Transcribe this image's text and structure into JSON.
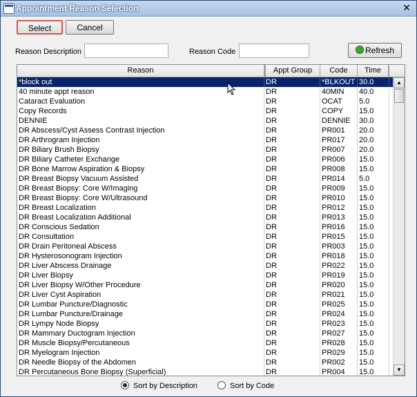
{
  "window": {
    "title": "Appointment Reason Selection",
    "close_glyph": "✕"
  },
  "toolbar": {
    "select_label": "Select",
    "cancel_label": "Cancel",
    "refresh_label": "Refresh",
    "refresh_icon": "refresh-icon"
  },
  "filters": {
    "reason_desc_label": "Reason Description",
    "reason_desc_value": "",
    "reason_code_label": "Reason Code",
    "reason_code_value": ""
  },
  "grid": {
    "columns": [
      "Reason",
      "Appt Group",
      "Code",
      "Time"
    ],
    "selected_index": 0,
    "rows": [
      [
        "*block out",
        "DR",
        "*BLKOUT",
        "30.0"
      ],
      [
        "40 minute appt reason",
        "DR",
        "40MIN",
        "40.0"
      ],
      [
        "Cataract Evaluation",
        "DR",
        "OCAT",
        "5.0"
      ],
      [
        "Copy Records",
        "DR",
        "COPY",
        "15.0"
      ],
      [
        "DENNIE",
        "DR",
        "DENNIE",
        "30.0"
      ],
      [
        "DR Abscess/Cyst Assess Contrast Injection",
        "DR",
        "PR001",
        "20.0"
      ],
      [
        "DR Arthrogram Injection",
        "DR",
        "PR017",
        "20.0"
      ],
      [
        "DR Biliary Brush Biopsy",
        "DR",
        "PR007",
        "20.0"
      ],
      [
        "DR Biliary Catheter Exchange",
        "DR",
        "PR006",
        "15.0"
      ],
      [
        "DR Bone Marrow Aspiration & Biopsy",
        "DR",
        "PR008",
        "15.0"
      ],
      [
        "DR Breast Biopsy Vacuum Assisted",
        "DR",
        "PR014",
        "5.0"
      ],
      [
        "DR Breast Biopsy: Core W/Imaging",
        "DR",
        "PR009",
        "15.0"
      ],
      [
        "DR Breast Biopsy: Core W/Ultrasound",
        "DR",
        "PR010",
        "15.0"
      ],
      [
        "DR Breast Localization",
        "DR",
        "PR012",
        "15.0"
      ],
      [
        "DR Breast Localization Additional",
        "DR",
        "PR013",
        "15.0"
      ],
      [
        "DR Conscious Sedation",
        "DR",
        "PR016",
        "15.0"
      ],
      [
        "DR Consultation",
        "DR",
        "PR015",
        "15.0"
      ],
      [
        "DR Drain Peritoneal Abscess",
        "DR",
        "PR003",
        "15.0"
      ],
      [
        "DR Hysterosonogram Injection",
        "DR",
        "PR018",
        "15.0"
      ],
      [
        "DR Liver Abscess Drainage",
        "DR",
        "PR022",
        "15.0"
      ],
      [
        "DR Liver Biopsy",
        "DR",
        "PR019",
        "15.0"
      ],
      [
        "DR Liver Biopsy W/Other Procedure",
        "DR",
        "PR020",
        "15.0"
      ],
      [
        "DR Liver Cyst Aspiration",
        "DR",
        "PR021",
        "15.0"
      ],
      [
        "DR Lumbar Puncture/Diagnostic",
        "DR",
        "PR025",
        "15.0"
      ],
      [
        "DR Lumbar Puncture/Drainage",
        "DR",
        "PR024",
        "15.0"
      ],
      [
        "DR Lympy Node Biopsy",
        "DR",
        "PR023",
        "15.0"
      ],
      [
        "DR Mammary Ductogram Injection",
        "DR",
        "PR027",
        "15.0"
      ],
      [
        "DR Muscle Biopsy/Percutaneous",
        "DR",
        "PR028",
        "15.0"
      ],
      [
        "DR Myelogram Injection",
        "DR",
        "PR029",
        "15.0"
      ],
      [
        "DR Needle Biopsy of the Abdomen",
        "DR",
        "PR002",
        "15.0"
      ],
      [
        "DR Percutaneous Bone Biopsy (Superficial)",
        "DR",
        "PR004",
        "15.0"
      ]
    ]
  },
  "sort": {
    "by_description_label": "Sort by Description",
    "by_code_label": "Sort by Code",
    "selected": "description"
  },
  "colors": {
    "selection": "#0a246a",
    "select_button_border": "#d9534f"
  }
}
